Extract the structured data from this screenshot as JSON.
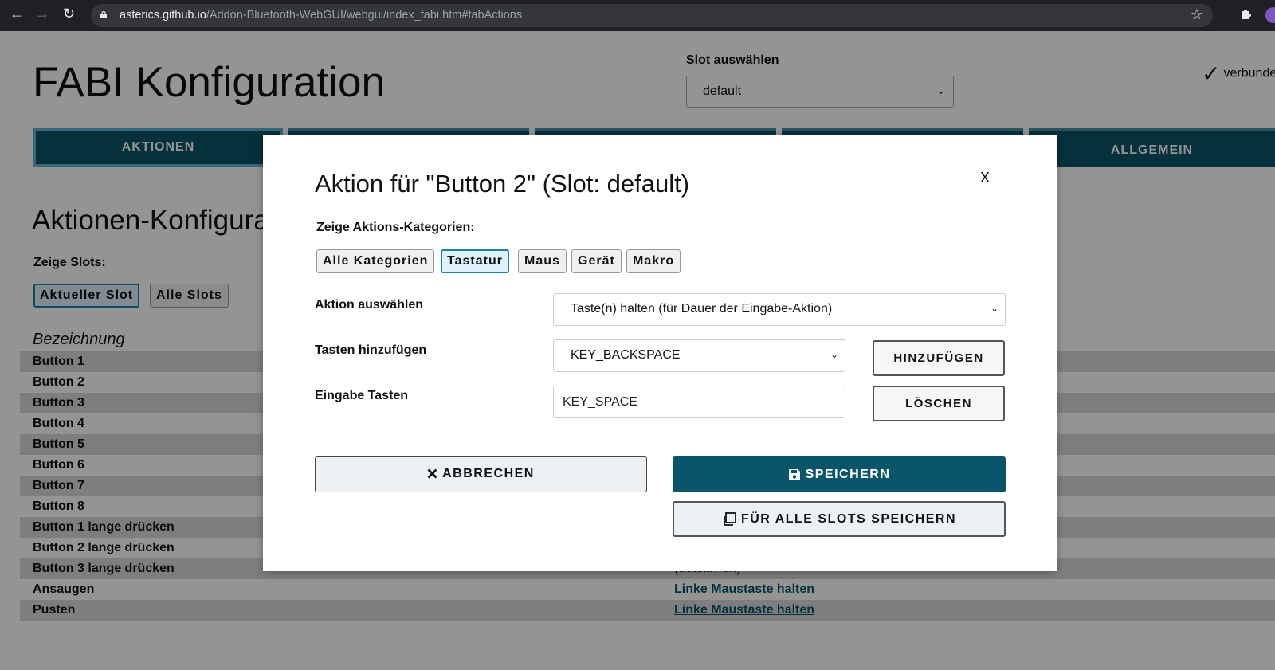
{
  "browser": {
    "url_host": "asterics.github.io",
    "url_path": "/Addon-Bluetooth-WebGUI/webgui/index_fabi.htm#tabActions"
  },
  "header": {
    "title": "FABI Konfiguration",
    "slot_label": "Slot auswählen",
    "slot_value": "default",
    "connection_status": "verbunden"
  },
  "tabs": [
    {
      "label": "AKTIONEN"
    },
    {
      "label": ""
    },
    {
      "label": ""
    },
    {
      "label": ""
    },
    {
      "label": "ALLGEMEIN"
    }
  ],
  "actions_page": {
    "title": "Aktionen-Konfiguration",
    "show_slots_label": "Zeige Slots:",
    "slot_filters": [
      "Aktueller Slot",
      "Alle Slots"
    ],
    "column_header": "Bezeichnung",
    "rows": [
      {
        "name": "Button 1",
        "action": ""
      },
      {
        "name": "Button 2",
        "action": ""
      },
      {
        "name": "Button 3",
        "action": ""
      },
      {
        "name": "Button 4",
        "action": ""
      },
      {
        "name": "Button 5",
        "action": ""
      },
      {
        "name": "Button 6",
        "action": ""
      },
      {
        "name": "Button 7",
        "action": ""
      },
      {
        "name": "Button 8",
        "action": ""
      },
      {
        "name": "Button 1 lange drücken",
        "action": ""
      },
      {
        "name": "Button 2 lange drücken",
        "action": ""
      },
      {
        "name": "Button 3 lange drücken",
        "action": "(deaktiviert)"
      },
      {
        "name": "Ansaugen",
        "action": "Linke Maustaste halten"
      },
      {
        "name": "Pusten",
        "action": "Linke Maustaste halten"
      }
    ]
  },
  "modal": {
    "title": "Aktion für \"Button 2\" (Slot: default)",
    "close_label": "X",
    "categories_label": "Zeige Aktions-Kategorien:",
    "categories": [
      "Alle Kategorien",
      "Tastatur",
      "Maus",
      "Gerät",
      "Makro"
    ],
    "action_label": "Aktion auswählen",
    "action_value": "Taste(n) halten (für Dauer der Eingabe-Aktion)",
    "keys_label": "Tasten hinzufügen",
    "keys_value": "KEY_BACKSPACE",
    "add_button": "HINZUFÜGEN",
    "input_keys_label": "Eingabe Tasten",
    "input_keys_value": "KEY_SPACE",
    "delete_button": "LÖSCHEN",
    "cancel_button": "ABBRECHEN",
    "save_button": "SPEICHERN",
    "save_all_button": "FÜR ALLE SLOTS SPEICHERN"
  },
  "colors": {
    "primary": "#0a5569",
    "active_chip_border": "#1d7fa6",
    "overlay": "rgba(0,0,0,0.42)"
  }
}
